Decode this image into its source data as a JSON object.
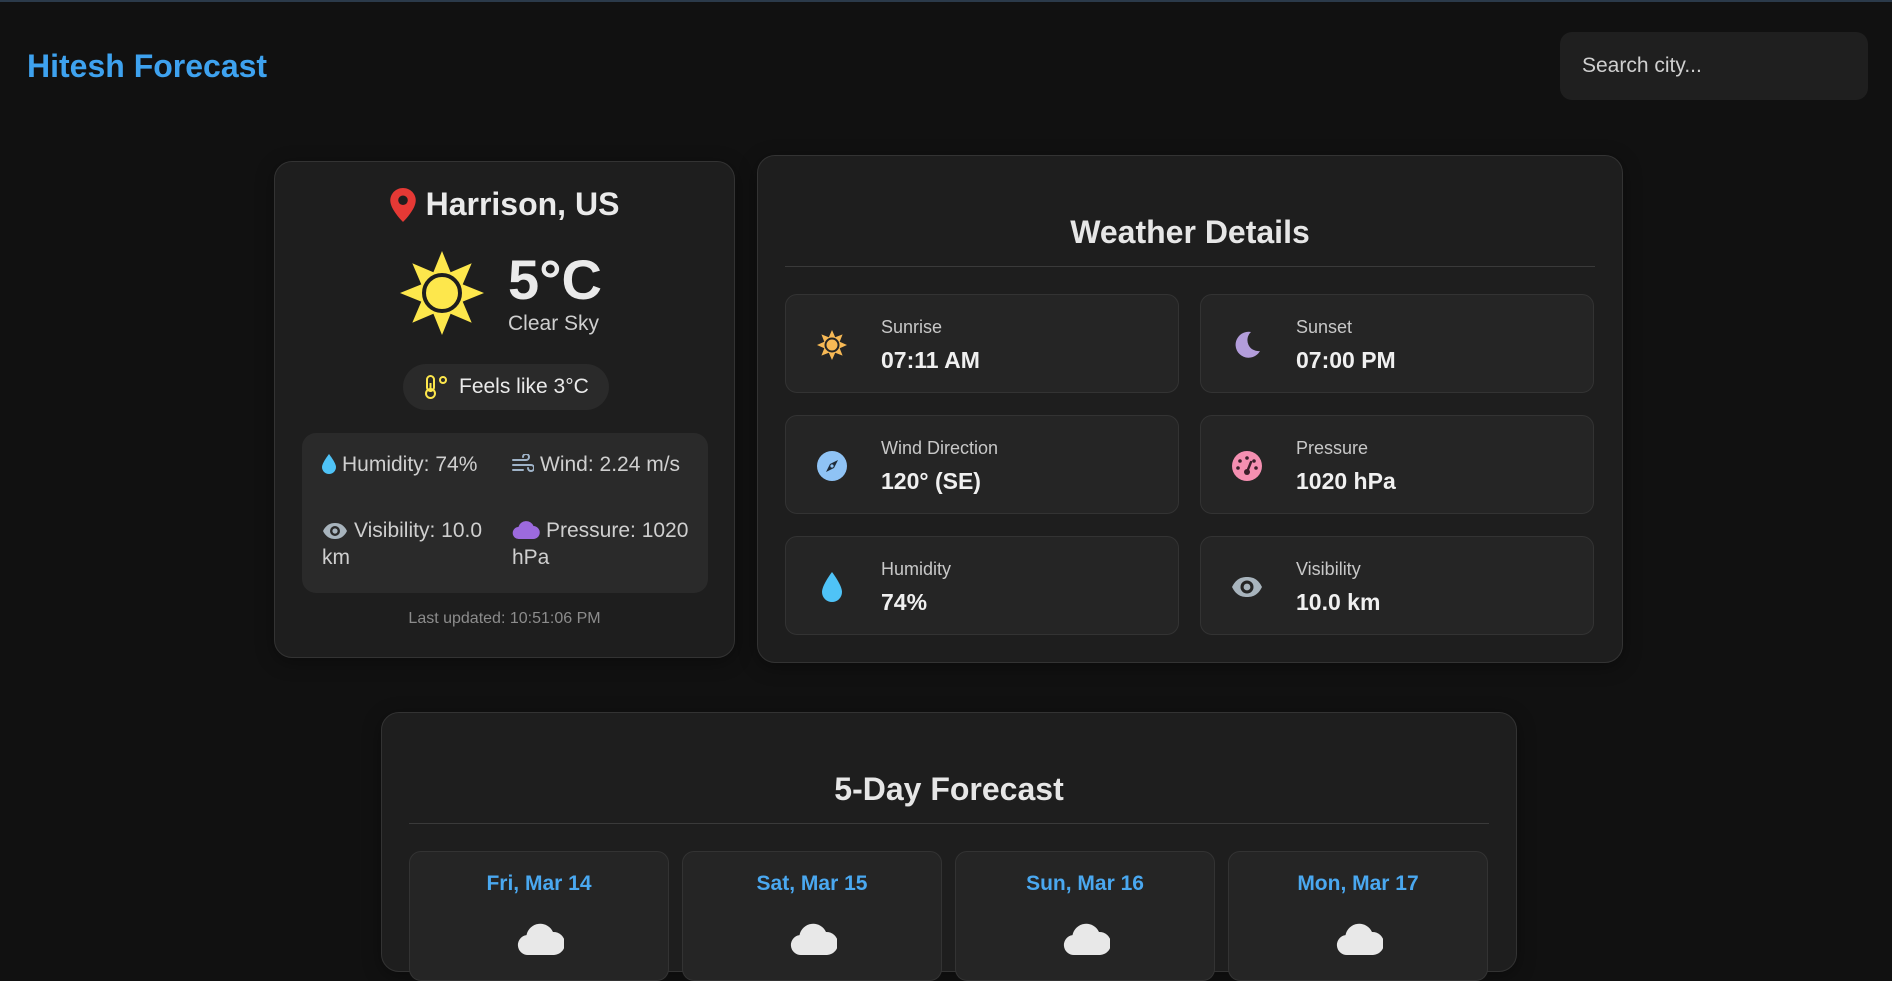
{
  "header": {
    "brand": "Hitesh Forecast",
    "search_placeholder": "Search city..."
  },
  "current": {
    "location": "Harrison, US",
    "temperature": "5°C",
    "condition": "Clear Sky",
    "feels_like": "Feels like 3°C",
    "stats": {
      "humidity": "Humidity: 74%",
      "wind": "Wind: 2.24 m/s",
      "visibility": "Visibility: 10.0 km",
      "pressure": "Pressure: 1020 hPa"
    },
    "last_updated": "Last updated: 10:51:06 PM"
  },
  "details": {
    "title": "Weather Details",
    "items": [
      {
        "label": "Sunrise",
        "value": "07:11 AM",
        "icon": "sun-icon",
        "color": "#f7b955"
      },
      {
        "label": "Sunset",
        "value": "07:00 PM",
        "icon": "moon-icon",
        "color": "#b39ddb"
      },
      {
        "label": "Wind Direction",
        "value": "120° (SE)",
        "icon": "compass-icon",
        "color": "#8fc3f5"
      },
      {
        "label": "Pressure",
        "value": "1020 hPa",
        "icon": "gauge-icon",
        "color": "#f48fb1"
      },
      {
        "label": "Humidity",
        "value": "74%",
        "icon": "droplet-icon",
        "color": "#4fc3f7"
      },
      {
        "label": "Visibility",
        "value": "10.0 km",
        "icon": "eye-icon",
        "color": "#a8b4bd"
      }
    ]
  },
  "forecast": {
    "title": "5-Day Forecast",
    "days": [
      {
        "label": "Fri, Mar 14",
        "icon": "cloud-icon"
      },
      {
        "label": "Sat, Mar 15",
        "icon": "cloud-icon"
      },
      {
        "label": "Sun, Mar 16",
        "icon": "cloud-icon"
      },
      {
        "label": "Mon, Mar 17",
        "icon": "cloud-icon"
      }
    ]
  },
  "colors": {
    "background": "#111111",
    "card": "#1e1e1e",
    "accent": "#3ea2ef",
    "sun": "#fde74c",
    "location_pin": "#e53935"
  }
}
